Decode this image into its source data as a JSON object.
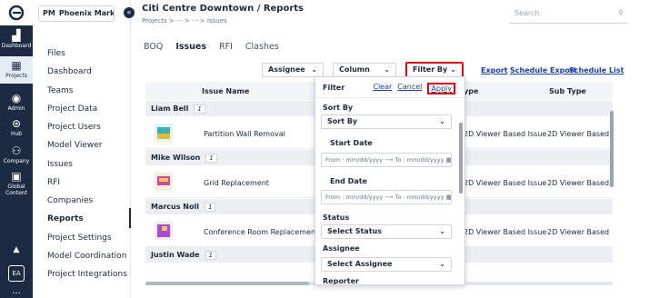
{
  "rail": {
    "items": [
      {
        "label": "Dashboard",
        "icon": "chart-icon"
      },
      {
        "label": "Projects",
        "icon": "projects-icon"
      },
      {
        "label": "Admin",
        "icon": "admin-icon"
      },
      {
        "label": "Hub",
        "icon": "hub-icon"
      },
      {
        "label": "Company",
        "icon": "company-icon"
      },
      {
        "label": "Global Content",
        "icon": "global-content-icon"
      }
    ],
    "avatar": "EA",
    "more": "..."
  },
  "project": {
    "badge": "PM",
    "name": "Phoenix Mark···"
  },
  "nav": {
    "items": [
      "Files",
      "Dashboard",
      "Teams",
      "Project Data",
      "Project Users",
      "Model Viewer",
      "Issues",
      "RFI",
      "Companies",
      "Reports",
      "Project Settings",
      "Model Coordination",
      "Project Integrations"
    ],
    "active": "Reports"
  },
  "header": {
    "title": "Citi Centre Downtown / Reports",
    "breadcrumb": "Projects > ··· > ··· > Issues",
    "search_placeholder": "Search"
  },
  "tabs": [
    "BOQ",
    "Issues",
    "RFI",
    "Clashes"
  ],
  "active_tab": "Issues",
  "toolbar": {
    "assignee": "Assignee",
    "column": "Column",
    "filter_by": "Filter By",
    "export": "Export",
    "schedule_export": "Schedule Export",
    "schedule_list": "Schedule List"
  },
  "table": {
    "columns": {
      "name": "Issue Name",
      "type": "ype",
      "subtype": "Sub Type"
    },
    "groups": [
      {
        "person": "Liam Bell",
        "count": "1",
        "issue": "Partition Wall Removal",
        "type": "2D Viewer Based Issue",
        "subtype": "2D Viewer Based Is"
      },
      {
        "person": "Mike Wilson",
        "count": "1",
        "issue": "Grid Replacement",
        "type": "2D Viewer Based Issue",
        "subtype": "2D Viewer Based Is"
      },
      {
        "person": "Marcus Noll",
        "count": "1",
        "issue": "Conference Room Replacement",
        "type": "2D Viewer Based Issue",
        "subtype": "2D Viewer Based Is"
      },
      {
        "person": "Justin Wade",
        "count": "1"
      }
    ]
  },
  "filter_panel": {
    "title": "Filter",
    "clear": "Clear",
    "cancel": "Cancel",
    "apply": "Apply",
    "sort_by_label": "Sort By",
    "sort_by_value": "Sort By",
    "start_date_label": "Start Date",
    "end_date_label": "End Date",
    "date_from": "From : mm/dd/yyyy",
    "date_arrow": "⟶",
    "date_to": "To : mm/dd/yyyy",
    "status_label": "Status",
    "status_value": "Select Status",
    "assignee_label": "Assignee",
    "assignee_value": "Select Assignee",
    "reporter_label": "Reporter"
  },
  "colors": {
    "navy": "#1c2a44",
    "highlight_red": "#e00012",
    "link_blue": "#1c3fa0"
  }
}
